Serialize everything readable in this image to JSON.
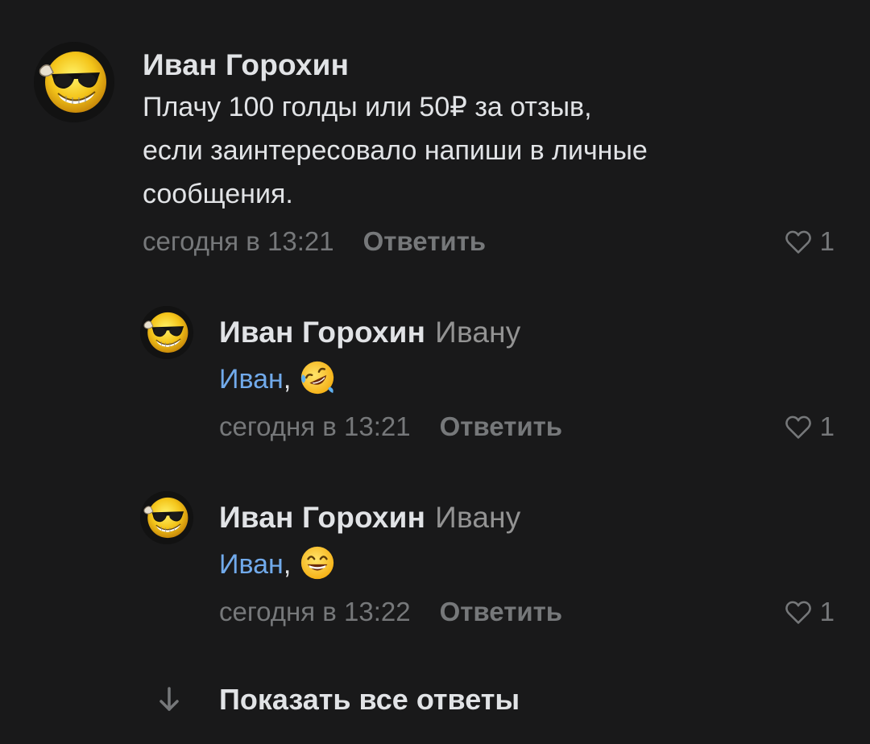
{
  "comments": [
    {
      "author": "Иван Горохин",
      "text_lines": [
        "Плачу 100 голды или 50₽ за отзыв,",
        "если заинтересовало напиши в личные",
        "сообщения."
      ],
      "time": "сегодня в 13:21",
      "reply_label": "Ответить",
      "likes": "1",
      "avatar_icon": "sunglasses-smiley-icon"
    }
  ],
  "replies": [
    {
      "author": "Иван Горохин",
      "reply_to": "Ивану",
      "mention": "Иван",
      "separator": ",",
      "emoji_icon": "rolling-on-floor-laughing-icon",
      "time": "сегодня в 13:21",
      "reply_label": "Ответить",
      "likes": "1"
    },
    {
      "author": "Иван Горохин",
      "reply_to": "Ивану",
      "mention": "Иван",
      "separator": ",",
      "emoji_icon": "grinning-smiley-icon",
      "time": "сегодня в 13:22",
      "reply_label": "Ответить",
      "likes": "1"
    }
  ],
  "show_all": {
    "label": "Показать все ответы",
    "icon": "arrow-down-icon"
  },
  "colors": {
    "background": "#19191a",
    "text": "#e1e3e6",
    "secondary": "#76787a",
    "mention": "#71aaeb"
  }
}
